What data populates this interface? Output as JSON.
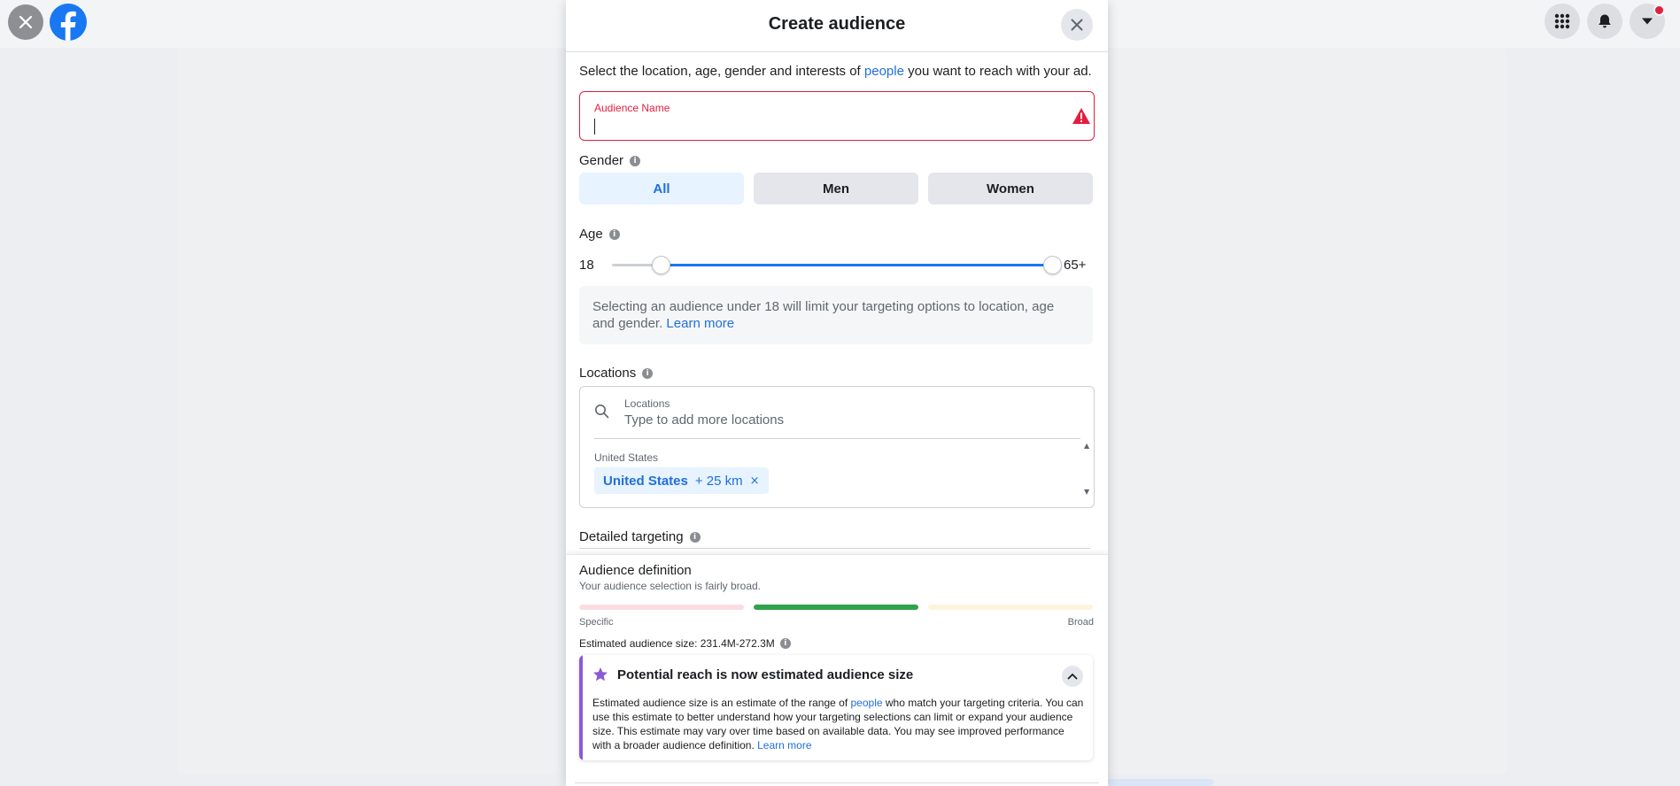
{
  "modal": {
    "title": "Create audience",
    "intro_before": "Select the location, age, gender and interests of ",
    "intro_link": "people",
    "intro_after": " you want to reach with your ad."
  },
  "audience_name": {
    "label": "Audience Name",
    "value": ""
  },
  "gender": {
    "label": "Gender",
    "options": [
      "All",
      "Men",
      "Women"
    ],
    "selected": "All"
  },
  "age": {
    "label": "Age",
    "min_label": "18",
    "max_label": "65+",
    "selected_min_fraction": 0.11,
    "selected_max_fraction": 1.0,
    "notice_text": "Selecting an audience under 18 will limit your targeting options to location, age and gender.",
    "notice_link": "Learn more"
  },
  "locations": {
    "label": "Locations",
    "field_label": "Locations",
    "placeholder": "Type to add more locations",
    "group_label": "United States",
    "chip_name": "United States",
    "chip_radius": "+ 25 km",
    "chip_remove": "×"
  },
  "detailed_targeting": {
    "label": "Detailed targeting"
  },
  "audience_definition": {
    "title": "Audience definition",
    "subtitle": "Your audience selection is fairly broad.",
    "specific_label": "Specific",
    "broad_label": "Broad",
    "estimated_size": "Estimated audience size: 231.4M-272.3M",
    "active_segment": 2
  },
  "reach_notice": {
    "title": "Potential reach is now estimated audience size",
    "body_1": "Estimated audience size is an estimate of the range of ",
    "body_link": "people",
    "body_2": " who match your targeting criteria. You can use this estimate to better understand how your targeting selections can limit or expand your audience size. This estimate may vary over time based on available data. You may see improved performance with a broader audience definition. ",
    "learn_more": "Learn more"
  },
  "icons": {
    "close": "close-icon",
    "brand": "facebook-logo",
    "menu": "apps-grid-icon",
    "notifications": "bell-icon",
    "account": "caret-down-icon",
    "warning": "warning-icon",
    "info": "info-icon",
    "search": "search-icon",
    "star": "star-icon",
    "collapse": "chevron-up-icon"
  },
  "colors": {
    "accent": "#1877f2",
    "link": "#216fdb",
    "error": "#e41e3f",
    "meter_specific": "#fbdde1",
    "meter_active": "#31a24c",
    "meter_broad": "#fdf3dd",
    "reach_accent": "#8a5ad6"
  }
}
